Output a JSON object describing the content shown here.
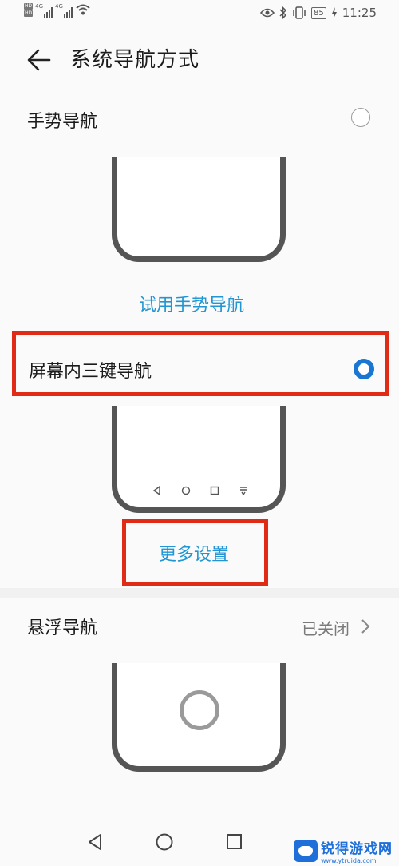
{
  "status": {
    "sim1": "4G",
    "sim2": "4G",
    "battery": "85",
    "time": "11:25"
  },
  "header": {
    "title": "系统导航方式"
  },
  "gesture": {
    "label": "手势导航",
    "selected": false,
    "try_link": "试用手势导航"
  },
  "three_key": {
    "label": "屏幕内三键导航",
    "selected": true,
    "more_settings": "更多设置"
  },
  "float": {
    "label": "悬浮导航",
    "status": "已关闭"
  },
  "watermark": {
    "name": "锐得游戏网",
    "url": "www.ytruida.com"
  },
  "colors": {
    "accent": "#2196d3",
    "radio_selected": "#1976d2",
    "highlight": "#e02b17"
  }
}
